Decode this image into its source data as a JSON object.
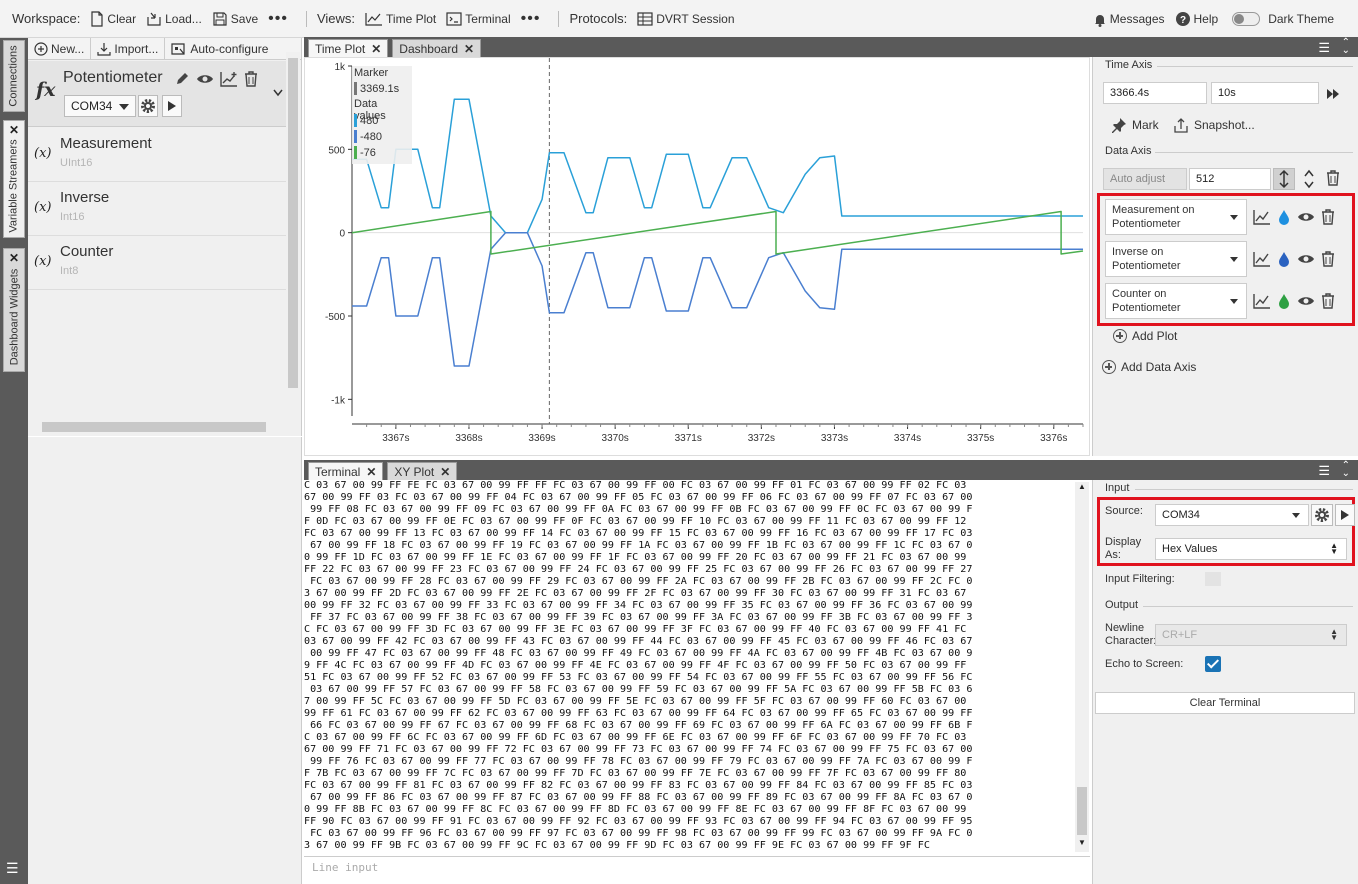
{
  "toolbar": {
    "workspace_label": "Workspace:",
    "clear": "Clear",
    "load": "Load...",
    "save": "Save",
    "views_label": "Views:",
    "time_plot": "Time Plot",
    "terminal": "Terminal",
    "protocols_label": "Protocols:",
    "dvrt": "DVRT Session",
    "messages": "Messages",
    "help": "Help",
    "dark_theme": "Dark Theme",
    "dark_theme_on": false
  },
  "side_tabs": {
    "connections": "Connections",
    "variable_streamers": "Variable Streamers",
    "dashboard_widgets": "Dashboard Widgets"
  },
  "left_panel": {
    "new": "New...",
    "import": "Import...",
    "auto_configure": "Auto-configure",
    "streamer": {
      "name": "Potentiometer",
      "port": "COM34"
    },
    "variables": [
      {
        "name": "Measurement",
        "type": "UInt16"
      },
      {
        "name": "Inverse",
        "type": "Int16"
      },
      {
        "name": "Counter",
        "type": "Int8"
      }
    ]
  },
  "top_tabs": [
    "Time Plot",
    "Dashboard"
  ],
  "chart_data": {
    "type": "line",
    "x_ticks": [
      "3367s",
      "3368s",
      "3369s",
      "3370s",
      "3371s",
      "3372s",
      "3373s",
      "3374s",
      "3375s",
      "3376s"
    ],
    "y_ticks": [
      "1k",
      "500",
      "0",
      "-500",
      "-1k"
    ],
    "ylim": [
      -1100,
      1000
    ],
    "xlim": [
      3366.4,
      3376.4
    ],
    "grid": false,
    "marker": {
      "label": "Marker",
      "time": "3369.1s",
      "x": 3369.1
    },
    "legend_title": "Data values",
    "legend_values": [
      {
        "value": "480",
        "color": "#2aa0d8"
      },
      {
        "value": "-480",
        "color": "#4a7fd0"
      },
      {
        "value": "-76",
        "color": "#4caf50"
      }
    ],
    "series": [
      {
        "color": "#2aa0d8",
        "points": [
          [
            3366.4,
            440
          ],
          [
            3366.6,
            440
          ],
          [
            3366.8,
            150
          ],
          [
            3366.9,
            150
          ],
          [
            3367.0,
            500
          ],
          [
            3367.3,
            500
          ],
          [
            3367.5,
            150
          ],
          [
            3367.6,
            150
          ],
          [
            3367.8,
            800
          ],
          [
            3368.0,
            800
          ],
          [
            3368.3,
            100
          ],
          [
            3368.5,
            0
          ],
          [
            3368.8,
            0
          ],
          [
            3369.0,
            200
          ],
          [
            3369.1,
            480
          ],
          [
            3369.3,
            480
          ],
          [
            3369.6,
            120
          ],
          [
            3369.7,
            120
          ],
          [
            3369.9,
            450
          ],
          [
            3370.2,
            450
          ],
          [
            3370.4,
            150
          ],
          [
            3370.5,
            150
          ],
          [
            3370.7,
            470
          ],
          [
            3371.0,
            470
          ],
          [
            3371.2,
            150
          ],
          [
            3371.3,
            150
          ],
          [
            3371.6,
            450
          ],
          [
            3371.8,
            450
          ],
          [
            3372.1,
            150
          ],
          [
            3372.3,
            120
          ],
          [
            3372.6,
            350
          ],
          [
            3372.8,
            450
          ],
          [
            3373.0,
            460
          ],
          [
            3373.1,
            100
          ],
          [
            3374.0,
            100
          ],
          [
            3375.0,
            100
          ],
          [
            3376.4,
            100
          ]
        ]
      },
      {
        "color": "#4a7fd0",
        "points": [
          [
            3366.4,
            -440
          ],
          [
            3366.6,
            -440
          ],
          [
            3366.8,
            -150
          ],
          [
            3366.9,
            -150
          ],
          [
            3367.0,
            -500
          ],
          [
            3367.3,
            -500
          ],
          [
            3367.5,
            -150
          ],
          [
            3367.6,
            -150
          ],
          [
            3367.8,
            -800
          ],
          [
            3368.0,
            -800
          ],
          [
            3368.3,
            -100
          ],
          [
            3368.5,
            0
          ],
          [
            3368.8,
            0
          ],
          [
            3369.0,
            -200
          ],
          [
            3369.1,
            -480
          ],
          [
            3369.3,
            -480
          ],
          [
            3369.6,
            -120
          ],
          [
            3369.7,
            -120
          ],
          [
            3369.9,
            -450
          ],
          [
            3370.2,
            -450
          ],
          [
            3370.4,
            -150
          ],
          [
            3370.5,
            -150
          ],
          [
            3370.7,
            -470
          ],
          [
            3371.0,
            -470
          ],
          [
            3371.2,
            -150
          ],
          [
            3371.3,
            -150
          ],
          [
            3371.6,
            -450
          ],
          [
            3371.8,
            -450
          ],
          [
            3372.1,
            -150
          ],
          [
            3372.3,
            -120
          ],
          [
            3372.6,
            -350
          ],
          [
            3372.8,
            -450
          ],
          [
            3373.0,
            -460
          ],
          [
            3373.1,
            -100
          ],
          [
            3374.0,
            -100
          ],
          [
            3375.0,
            -100
          ],
          [
            3376.4,
            -100
          ]
        ]
      },
      {
        "color": "#4caf50",
        "points": [
          [
            3366.4,
            0
          ],
          [
            3368.3,
            127
          ],
          [
            3368.3,
            -128
          ],
          [
            3372.2,
            127
          ],
          [
            3372.2,
            -128
          ],
          [
            3376.1,
            127
          ],
          [
            3376.1,
            -128
          ],
          [
            3376.4,
            -110
          ]
        ]
      }
    ]
  },
  "time_axis": {
    "title": "Time Axis",
    "start": "3366.4s",
    "span": "10s",
    "mark": "Mark",
    "snapshot": "Snapshot..."
  },
  "data_axis": {
    "title": "Data Axis",
    "auto_adjust": "Auto adjust",
    "value": "512",
    "plots": [
      {
        "line1": "Measurement on",
        "line2": "Potentiometer",
        "color": "#1e90e0"
      },
      {
        "line1": "Inverse on",
        "line2": "Potentiometer",
        "color": "#2a62c0"
      },
      {
        "line1": "Counter on",
        "line2": "Potentiometer",
        "color": "#2ea043"
      }
    ],
    "add_plot": "Add Plot",
    "add_data_axis": "Add Data Axis"
  },
  "bottom_tabs": [
    "Terminal",
    "XY Plot"
  ],
  "terminal": {
    "lines": [
      "C 03 67 00 99 FF FE FC 03 67 00 99 FF FF FC 03 67 00 99 FF 00 FC 03 67 00 99 FF 01 FC 03 67 00 99 FF 02 FC 03",
      "67 00 99 FF 03 FC 03 67 00 99 FF 04 FC 03 67 00 99 FF 05 FC 03 67 00 99 FF 06 FC 03 67 00 99 FF 07 FC 03 67 00",
      " 99 FF 08 FC 03 67 00 99 FF 09 FC 03 67 00 99 FF 0A FC 03 67 00 99 FF 0B FC 03 67 00 99 FF 0C FC 03 67 00 99 F",
      "F 0D FC 03 67 00 99 FF 0E FC 03 67 00 99 FF 0F FC 03 67 00 99 FF 10 FC 03 67 00 99 FF 11 FC 03 67 00 99 FF 12",
      "FC 03 67 00 99 FF 13 FC 03 67 00 99 FF 14 FC 03 67 00 99 FF 15 FC 03 67 00 99 FF 16 FC 03 67 00 99 FF 17 FC 03",
      " 67 00 99 FF 18 FC 03 67 00 99 FF 19 FC 03 67 00 99 FF 1A FC 03 67 00 99 FF 1B FC 03 67 00 99 FF 1C FC 03 67 0",
      "0 99 FF 1D FC 03 67 00 99 FF 1E FC 03 67 00 99 FF 1F FC 03 67 00 99 FF 20 FC 03 67 00 99 FF 21 FC 03 67 00 99",
      "FF 22 FC 03 67 00 99 FF 23 FC 03 67 00 99 FF 24 FC 03 67 00 99 FF 25 FC 03 67 00 99 FF 26 FC 03 67 00 99 FF 27",
      " FC 03 67 00 99 FF 28 FC 03 67 00 99 FF 29 FC 03 67 00 99 FF 2A FC 03 67 00 99 FF 2B FC 03 67 00 99 FF 2C FC 0",
      "3 67 00 99 FF 2D FC 03 67 00 99 FF 2E FC 03 67 00 99 FF 2F FC 03 67 00 99 FF 30 FC 03 67 00 99 FF 31 FC 03 67",
      "00 99 FF 32 FC 03 67 00 99 FF 33 FC 03 67 00 99 FF 34 FC 03 67 00 99 FF 35 FC 03 67 00 99 FF 36 FC 03 67 00 99",
      " FF 37 FC 03 67 00 99 FF 38 FC 03 67 00 99 FF 39 FC 03 67 00 99 FF 3A FC 03 67 00 99 FF 3B FC 03 67 00 99 FF 3",
      "C FC 03 67 00 99 FF 3D FC 03 67 00 99 FF 3E FC 03 67 00 99 FF 3F FC 03 67 00 99 FF 40 FC 03 67 00 99 FF 41 FC",
      "03 67 00 99 FF 42 FC 03 67 00 99 FF 43 FC 03 67 00 99 FF 44 FC 03 67 00 99 FF 45 FC 03 67 00 99 FF 46 FC 03 67",
      " 00 99 FF 47 FC 03 67 00 99 FF 48 FC 03 67 00 99 FF 49 FC 03 67 00 99 FF 4A FC 03 67 00 99 FF 4B FC 03 67 00 9",
      "9 FF 4C FC 03 67 00 99 FF 4D FC 03 67 00 99 FF 4E FC 03 67 00 99 FF 4F FC 03 67 00 99 FF 50 FC 03 67 00 99 FF",
      "51 FC 03 67 00 99 FF 52 FC 03 67 00 99 FF 53 FC 03 67 00 99 FF 54 FC 03 67 00 99 FF 55 FC 03 67 00 99 FF 56 FC",
      " 03 67 00 99 FF 57 FC 03 67 00 99 FF 58 FC 03 67 00 99 FF 59 FC 03 67 00 99 FF 5A FC 03 67 00 99 FF 5B FC 03 6",
      "7 00 99 FF 5C FC 03 67 00 99 FF 5D FC 03 67 00 99 FF 5E FC 03 67 00 99 FF 5F FC 03 67 00 99 FF 60 FC 03 67 00",
      "99 FF 61 FC 03 67 00 99 FF 62 FC 03 67 00 99 FF 63 FC 03 67 00 99 FF 64 FC 03 67 00 99 FF 65 FC 03 67 00 99 FF",
      " 66 FC 03 67 00 99 FF 67 FC 03 67 00 99 FF 68 FC 03 67 00 99 FF 69 FC 03 67 00 99 FF 6A FC 03 67 00 99 FF 6B F",
      "C 03 67 00 99 FF 6C FC 03 67 00 99 FF 6D FC 03 67 00 99 FF 6E FC 03 67 00 99 FF 6F FC 03 67 00 99 FF 70 FC 03",
      "67 00 99 FF 71 FC 03 67 00 99 FF 72 FC 03 67 00 99 FF 73 FC 03 67 00 99 FF 74 FC 03 67 00 99 FF 75 FC 03 67 00",
      " 99 FF 76 FC 03 67 00 99 FF 77 FC 03 67 00 99 FF 78 FC 03 67 00 99 FF 79 FC 03 67 00 99 FF 7A FC 03 67 00 99 F",
      "F 7B FC 03 67 00 99 FF 7C FC 03 67 00 99 FF 7D FC 03 67 00 99 FF 7E FC 03 67 00 99 FF 7F FC 03 67 00 99 FF 80",
      "FC 03 67 00 99 FF 81 FC 03 67 00 99 FF 82 FC 03 67 00 99 FF 83 FC 03 67 00 99 FF 84 FC 03 67 00 99 FF 85 FC 03",
      " 67 00 99 FF 86 FC 03 67 00 99 FF 87 FC 03 67 00 99 FF 88 FC 03 67 00 99 FF 89 FC 03 67 00 99 FF 8A FC 03 67 0",
      "0 99 FF 8B FC 03 67 00 99 FF 8C FC 03 67 00 99 FF 8D FC 03 67 00 99 FF 8E FC 03 67 00 99 FF 8F FC 03 67 00 99",
      "FF 90 FC 03 67 00 99 FF 91 FC 03 67 00 99 FF 92 FC 03 67 00 99 FF 93 FC 03 67 00 99 FF 94 FC 03 67 00 99 FF 95",
      " FC 03 67 00 99 FF 96 FC 03 67 00 99 FF 97 FC 03 67 00 99 FF 98 FC 03 67 00 99 FF 99 FC 03 67 00 99 FF 9A FC 0",
      "3 67 00 99 FF 9B FC 03 67 00 99 FF 9C FC 03 67 00 99 FF 9D FC 03 67 00 99 FF 9E FC 03 67 00 99 FF 9F FC"
    ],
    "line_input_placeholder": "Line input"
  },
  "input_panel": {
    "input_title": "Input",
    "source_label": "Source:",
    "source_value": "COM34",
    "display_as_label": "Display As:",
    "display_as_value": "Hex Values",
    "input_filtering_label": "Input Filtering:",
    "output_title": "Output",
    "newline_label": "Newline Character:",
    "newline_value": "CR+LF",
    "echo_label": "Echo to Screen:",
    "echo_checked": true,
    "clear_terminal": "Clear Terminal"
  }
}
